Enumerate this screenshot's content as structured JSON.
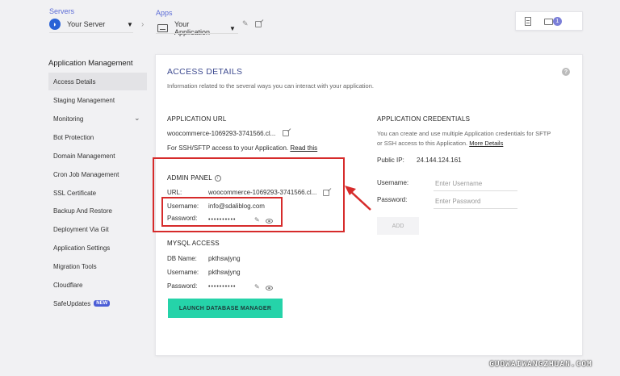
{
  "header": {
    "servers_label": "Servers",
    "server_name": "Your Server",
    "apps_label": "Apps",
    "app_name": "Your Application",
    "notification_count": "1"
  },
  "sidebar": {
    "title": "Application Management",
    "items": [
      {
        "label": "Access Details"
      },
      {
        "label": "Staging Management"
      },
      {
        "label": "Monitoring"
      },
      {
        "label": "Bot Protection"
      },
      {
        "label": "Domain Management"
      },
      {
        "label": "Cron Job Management"
      },
      {
        "label": "SSL Certificate"
      },
      {
        "label": "Backup And Restore"
      },
      {
        "label": "Deployment Via Git"
      },
      {
        "label": "Application Settings"
      },
      {
        "label": "Migration Tools"
      },
      {
        "label": "Cloudflare"
      },
      {
        "label": "SafeUpdates",
        "badge": "NEW"
      }
    ]
  },
  "access": {
    "title": "ACCESS DETAILS",
    "subtitle": "Information related to the several ways you can interact with your application.",
    "app_url_heading": "APPLICATION URL",
    "app_url_value": "woocommerce-1069293-3741566.cl...",
    "ssh_note": "For SSH/SFTP access to your Application.",
    "ssh_link": "Read this",
    "admin_heading": "ADMIN PANEL",
    "admin_url_label": "URL:",
    "admin_url_value": "woocommerce-1069293-3741566.cl...",
    "admin_user_label": "Username:",
    "admin_user_value": "info@sdaliblog.com",
    "admin_pass_label": "Password:",
    "admin_pass_value": "••••••••••",
    "mysql_heading": "MYSQL ACCESS",
    "db_name_label": "DB Name:",
    "db_name_value": "pkthswjyng",
    "db_user_label": "Username:",
    "db_user_value": "pkthswjyng",
    "db_pass_label": "Password:",
    "db_pass_value": "••••••••••",
    "launch_button": "LAUNCH DATABASE MANAGER"
  },
  "credentials": {
    "heading": "APPLICATION CREDENTIALS",
    "desc_line1": "You can create and use multiple Application credentials for SFTP",
    "desc_line2": "or SSH access to this Application.",
    "more_link": "More Details",
    "public_ip_label": "Public IP:",
    "public_ip_value": "24.144.124.161",
    "username_label": "Username:",
    "username_placeholder": "Enter Username",
    "password_label": "Password:",
    "password_placeholder": "Enter Password",
    "add_button": "ADD"
  },
  "watermark": "GUOWAIWANGZHUAN.COM",
  "colors": {
    "accent": "#3d4a8f",
    "launch_button": "#25d3a9",
    "highlight_red": "#d62b2b",
    "new_badge": "#4b5dd6"
  }
}
